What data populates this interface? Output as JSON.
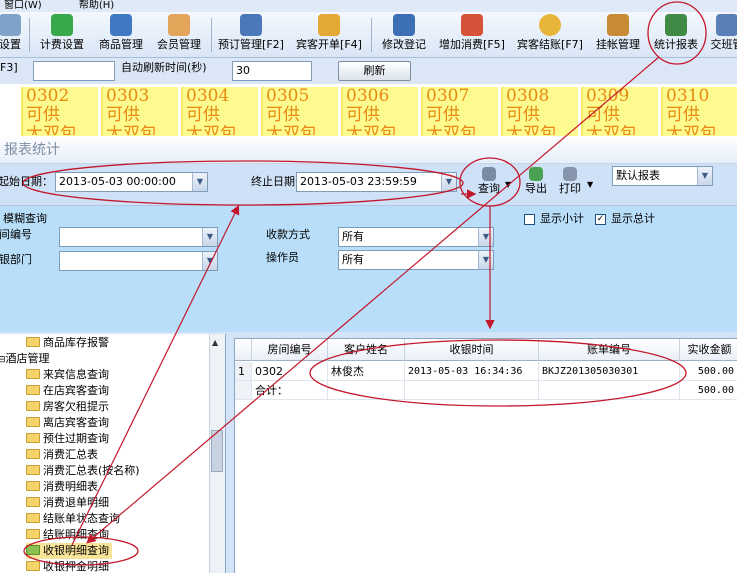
{
  "menu": {
    "window": "窗口(W)",
    "help": "帮助(H)"
  },
  "toolbar": {
    "items": [
      {
        "label": "设置"
      },
      {
        "label": "计费设置"
      },
      {
        "label": "商品管理"
      },
      {
        "label": "会员管理"
      },
      {
        "label": "预订管理[F2]"
      },
      {
        "label": "宾客开单[F4]"
      },
      {
        "label": "修改登记"
      },
      {
        "label": "增加消费[F5]"
      },
      {
        "label": "宾客结账[F7]"
      },
      {
        "label": "挂帐管理"
      },
      {
        "label": "统计报表"
      },
      {
        "label": "交班管"
      }
    ]
  },
  "bar2": {
    "key_hint": "F3]",
    "auto_refresh_label": "自动刷新时间(秒)",
    "auto_refresh_value": "30",
    "refresh_button": "刷新"
  },
  "rooms": [
    {
      "number": "0302",
      "status": "可供",
      "type": "大双包"
    },
    {
      "number": "0303",
      "status": "可供",
      "type": "大双包"
    },
    {
      "number": "0304",
      "status": "可供",
      "type": "大双包"
    },
    {
      "number": "0305",
      "status": "可供",
      "type": "大双包"
    },
    {
      "number": "0306",
      "status": "可供",
      "type": "大双包"
    },
    {
      "number": "0307",
      "status": "可供",
      "type": "大双包"
    },
    {
      "number": "0308",
      "status": "可供",
      "type": "大双包"
    },
    {
      "number": "0309",
      "status": "可供",
      "type": "大双包"
    },
    {
      "number": "0310",
      "status": "可供",
      "type": "大双包"
    }
  ],
  "report": {
    "title": "报表统计",
    "start_label": "起始日期：",
    "start_value": "2013-05-03 00:00:00",
    "end_label": "终止日期：",
    "end_value": "2013-05-03 23:59:59",
    "query_button": "查询",
    "export_button": "导出",
    "print_button": "打印",
    "report_select": "默认报表"
  },
  "filters": {
    "fuzzy_label": "模糊查询",
    "room_label": "间编号",
    "dept_label": "银部门",
    "pay_label": "收款方式",
    "pay_value": "所有",
    "operator_label": "操作员",
    "operator_value": "所有",
    "show_subtotal": "显示小计",
    "show_total": "显示总计",
    "subtotal_checked": "",
    "total_checked": "✓"
  },
  "tree": {
    "items": [
      {
        "label": "商品库存报警"
      },
      {
        "label": "酒店管理"
      },
      {
        "label": "来宾信息查询"
      },
      {
        "label": "在店宾客查询"
      },
      {
        "label": "房客欠租提示"
      },
      {
        "label": "离店宾客查询"
      },
      {
        "label": "预住过期查询"
      },
      {
        "label": "消费汇总表"
      },
      {
        "label": "消费汇总表(按名称)"
      },
      {
        "label": "消费明细表"
      },
      {
        "label": "消费退单明细"
      },
      {
        "label": "结账单状态查询"
      },
      {
        "label": "结账明细查询"
      },
      {
        "label": "收银明细查询"
      },
      {
        "label": "收银押金明细"
      }
    ]
  },
  "grid": {
    "columns": [
      "房间编号",
      "客户姓名",
      "收银时间",
      "账单编号",
      "实收金额"
    ],
    "rows": [
      {
        "index": "1",
        "room": "0302",
        "name": "林俊杰",
        "time": "2013-05-03 16:34:36",
        "bill": "BKJZ201305030301",
        "amount": "500.00"
      }
    ],
    "total_label": "合计：",
    "total_amount": "500.00"
  },
  "colors": {
    "annotation": "#c3172c",
    "room_bg": "#fdfb8f",
    "room_text": "#e88a12"
  }
}
